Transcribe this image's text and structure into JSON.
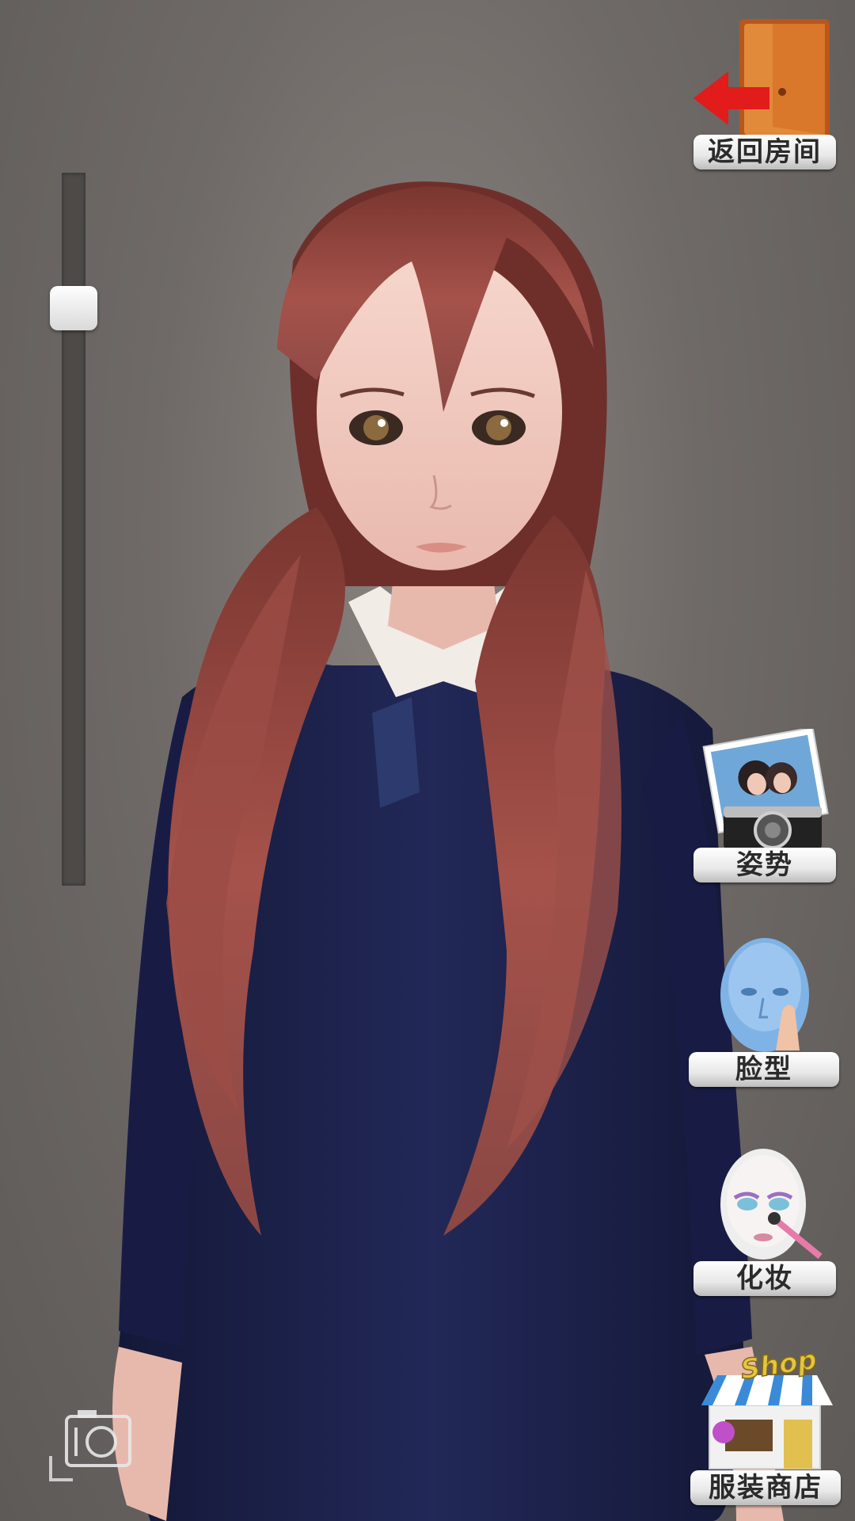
{
  "buttons": {
    "exit_room": "返回房间",
    "pose": "姿势",
    "face_shape": "脸型",
    "makeup": "化妆",
    "clothing_store": "服装商店",
    "shop_sign": "Shop"
  },
  "zoom": {
    "level": 0.17
  },
  "icons": {
    "exit": "door-exit-icon",
    "pose": "camera-photo-icon",
    "face": "face-head-icon",
    "makeup": "makeup-brush-icon",
    "shop": "shop-stall-icon",
    "screenshot": "camera-icon"
  },
  "colors": {
    "background": "#6f6a67",
    "button_face": "#f2f2f2",
    "hair": "#8a3e36",
    "sweater": "#1c2148"
  }
}
